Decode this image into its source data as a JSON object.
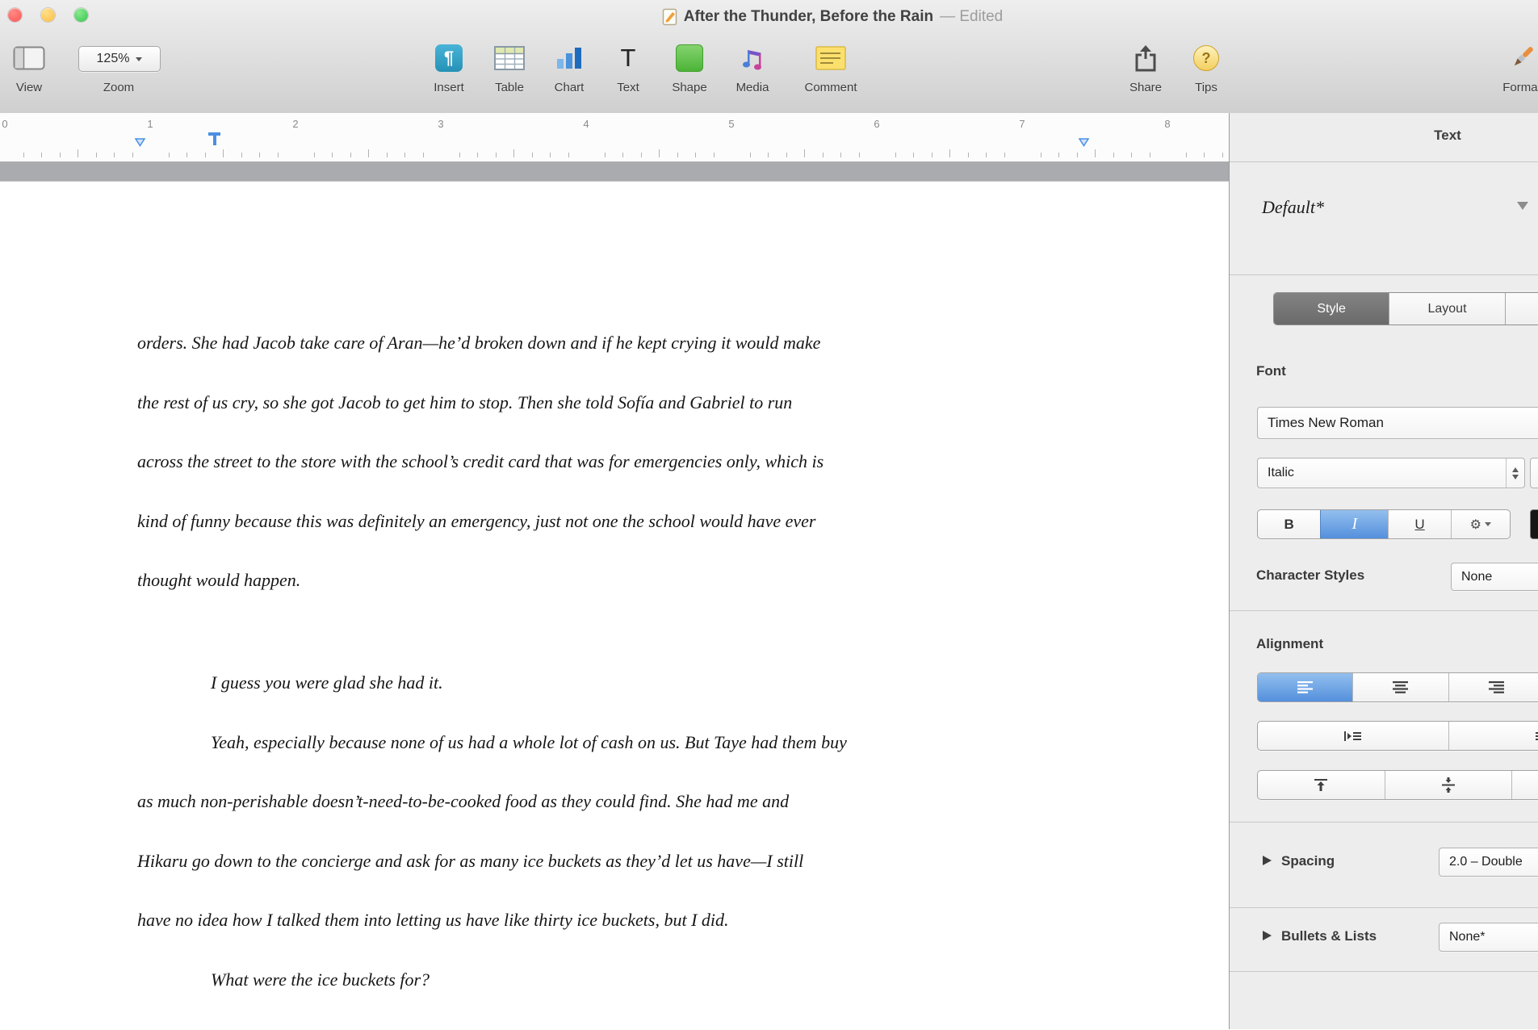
{
  "window": {
    "title": "After the Thunder, Before the Rain",
    "edited": "— Edited"
  },
  "toolbar": {
    "view_label": "View",
    "zoom_value": "125%",
    "zoom_label": "Zoom",
    "insert_label": "Insert",
    "insert_glyph": "¶",
    "table_label": "Table",
    "chart_label": "Chart",
    "text_label": "Text",
    "text_glyph": "T",
    "shape_label": "Shape",
    "media_label": "Media",
    "comment_label": "Comment",
    "share_label": "Share",
    "tips_label": "Tips",
    "tips_glyph": "?",
    "format_label": "Format"
  },
  "ruler": {
    "inch_labels": [
      "0",
      "1",
      "2",
      "3",
      "4",
      "5",
      "6",
      "7",
      "8"
    ]
  },
  "document": {
    "paragraphs": [
      {
        "indent_first": false,
        "lines": [
          "orders. She had Jacob take care of Aran—he’d broken down and if he kept crying it would make",
          "the rest of us cry, so she got Jacob to get him to stop. Then she told Sofía and Gabriel to run",
          "across the street to the store with the school’s credit card that was for emergencies only, which is",
          "kind of funny because this was definitely an emergency, just not one the school would have ever",
          "thought would happen."
        ]
      },
      {
        "indent_first": true,
        "lines": [
          "I guess you were glad she had it."
        ]
      },
      {
        "indent_first": true,
        "lines": [
          "Yeah, especially because none of us had a whole lot of cash on us. But Taye had them buy",
          "as much non-perishable doesn’t-need-to-be-cooked food as they could find. She had me and",
          "Hikaru go down to the concierge and ask for as many ice buckets as they’d let us have—I still",
          "have no idea how I talked them into letting us have like thirty ice buckets, but I did."
        ]
      },
      {
        "indent_first": true,
        "lines": [
          "What were the ice buckets for?"
        ]
      }
    ]
  },
  "sidebar": {
    "panel_title": "Text",
    "paragraph_style": "Default*",
    "tabs": [
      {
        "label": "Style"
      },
      {
        "label": "Layout"
      },
      {
        "label": ""
      }
    ],
    "font": {
      "section_label": "Font",
      "family": "Times New Roman",
      "typeface": "Italic",
      "bold_label": "B",
      "italic_label": "I",
      "underline_label": "U"
    },
    "character_styles": {
      "label": "Character Styles",
      "value": "None"
    },
    "alignment_label": "Alignment",
    "spacing": {
      "label": "Spacing",
      "value": "2.0 – Double"
    },
    "bullets": {
      "label": "Bullets & Lists",
      "value": "None*"
    }
  },
  "colors": {
    "accent_blue": "#5490dc",
    "selected_tab_gray": "#6a6a6a",
    "traffic_red": "#fc5753",
    "traffic_yellow": "#fdbc40",
    "traffic_green": "#34c84a"
  }
}
